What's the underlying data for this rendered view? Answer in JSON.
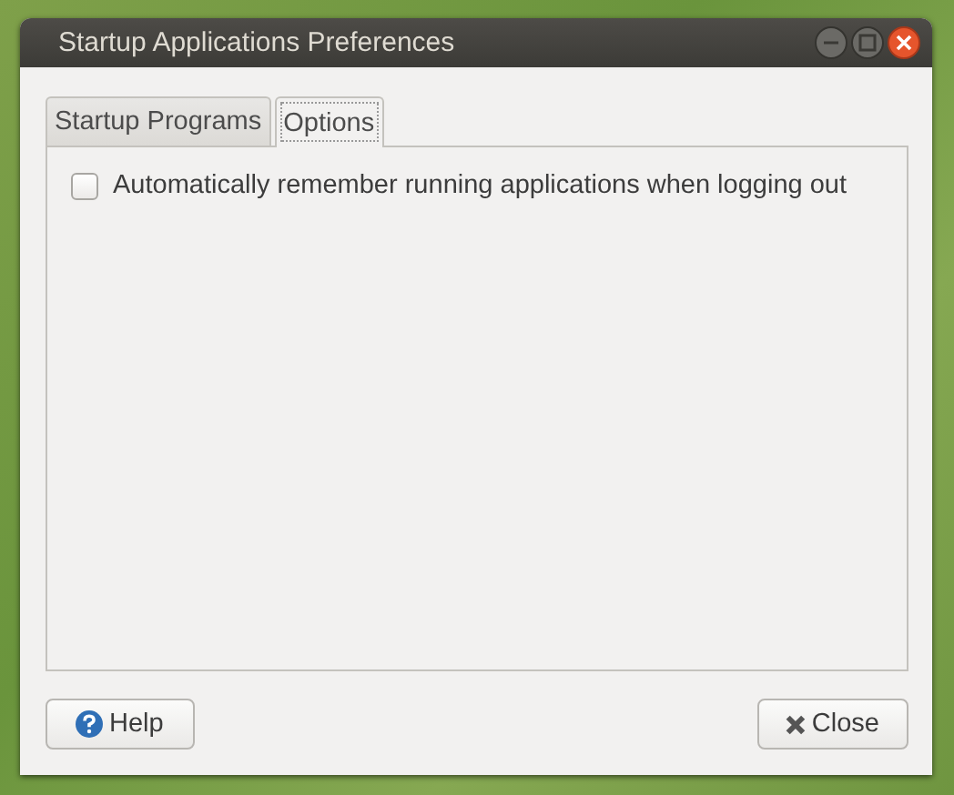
{
  "window": {
    "title": "Startup Applications Preferences"
  },
  "tabs": [
    {
      "label": "Startup Programs",
      "selected": false
    },
    {
      "label": "Options",
      "selected": true
    }
  ],
  "options": [
    {
      "label": "Automatically remember running applications when logging out",
      "checked": false
    }
  ],
  "buttons": [
    {
      "label": "Help",
      "kind": "help"
    },
    {
      "label": "Close",
      "kind": "close"
    }
  ]
}
